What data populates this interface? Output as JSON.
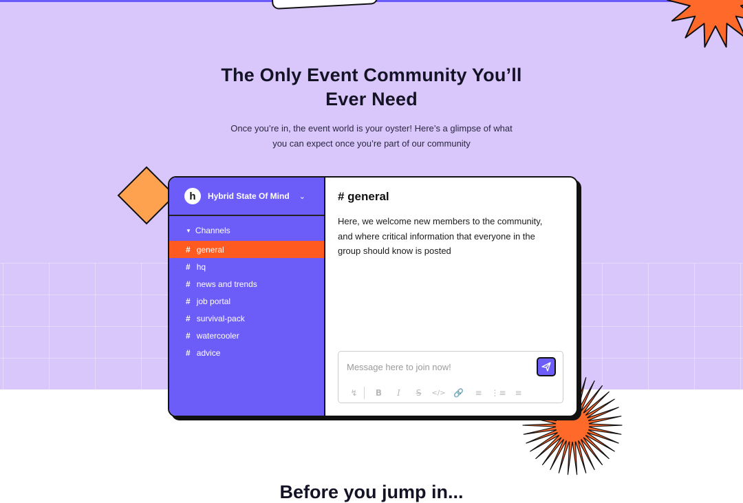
{
  "hero": {
    "title_line1": "The Only Event Community You’ll",
    "title_line2": "Ever Need",
    "subtitle_line1": "Once you’re in, the event world is your oyster! Here’s a glimpse of what",
    "subtitle_line2": "you can expect once you’re part of our community"
  },
  "sidebar": {
    "server_logo": "h",
    "server_name": "Hybrid State Of Mind",
    "channels_label": "Channels",
    "channels": [
      {
        "name": "general",
        "active": true
      },
      {
        "name": "hq"
      },
      {
        "name": "news and trends"
      },
      {
        "name": "job portal"
      },
      {
        "name": "survival-pack"
      },
      {
        "name": "watercooler"
      },
      {
        "name": "advice"
      }
    ]
  },
  "main": {
    "channel_title": "# general",
    "description": "Here, we welcome new members to the community, and where critical information that everyone in the group should know is posted"
  },
  "composer": {
    "placeholder": "Message here to join now!",
    "toolbar_icons": [
      "lightning-icon",
      "bold-icon",
      "italic-icon",
      "strikethrough-icon",
      "code-icon",
      "link-icon",
      "ordered-list-icon",
      "bullet-list-icon",
      "indent-list-icon"
    ]
  },
  "next_section": {
    "heading": "Before you jump in..."
  },
  "colors": {
    "hero_bg": "#d9c6fb",
    "sidebar_bg": "#6d5df8",
    "active_channel": "#ff5a1f",
    "deco_orange": "#ff6a2b",
    "diamond": "#ffa24f"
  }
}
